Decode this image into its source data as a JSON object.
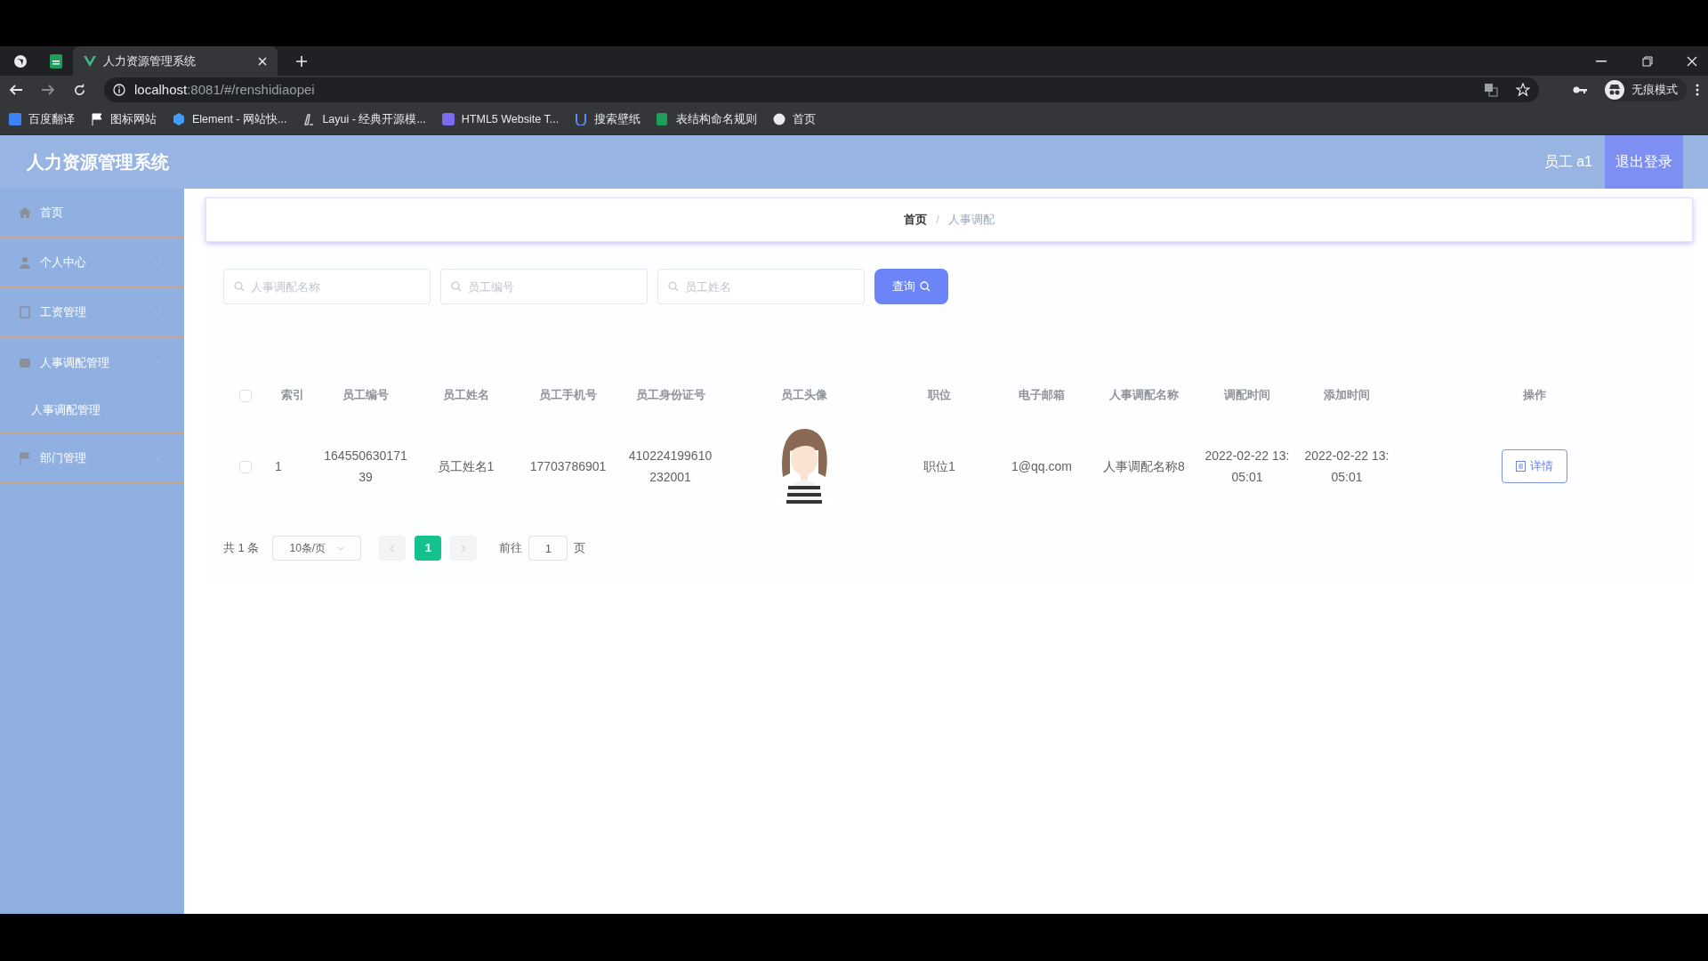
{
  "browser": {
    "tabs": [
      {
        "title": "人力资源管理系统",
        "selected": true
      }
    ],
    "address": {
      "host": "localhost",
      "rest": ":8081/#/renshidiaopei"
    },
    "bookmarks": [
      "百度翻译",
      "图标网站",
      "Element - 网站快...",
      "Layui - 经典开源模...",
      "HTML5 Website T...",
      "搜索壁纸",
      "表结构命名规则",
      "首页"
    ],
    "profile": "无痕模式"
  },
  "app": {
    "title": "人力资源管理系统",
    "user": "员工 a1",
    "logout": "退出登录"
  },
  "sidebar": {
    "items": [
      {
        "label": "首页"
      },
      {
        "label": "个人中心",
        "expanded": false
      },
      {
        "label": "工资管理",
        "expanded": false
      },
      {
        "label": "人事调配管理",
        "expanded": true,
        "children": [
          {
            "label": "人事调配管理"
          }
        ]
      },
      {
        "label": "部门管理",
        "expanded": false
      }
    ]
  },
  "breadcrumb": [
    "首页",
    "人事调配"
  ],
  "breadcrumb_separator": "/",
  "search": {
    "fields": [
      {
        "placeholder": "人事调配名称"
      },
      {
        "placeholder": "员工编号"
      },
      {
        "placeholder": "员工姓名"
      }
    ],
    "button": "查询"
  },
  "table": {
    "columns": [
      "索引",
      "员工编号",
      "员工姓名",
      "员工手机号",
      "员工身份证号",
      "员工头像",
      "职位",
      "电子邮箱",
      "人事调配名称",
      "调配时间",
      "添加时间",
      "操作"
    ],
    "header_checked": false,
    "rows": [
      {
        "checked": false,
        "cells": [
          "1",
          "16455063017139",
          "员工姓名1",
          "17703786901",
          "410224199610232001",
          {
            "kind": "picture"
          },
          "职位1",
          "1@qq.com",
          "人事调配名称8",
          "2022-02-22 13:05:01",
          "2022-02-22 13:05:01"
        ],
        "action": "详情"
      }
    ]
  },
  "pagination": {
    "total": "共 1 条",
    "page_size": "10条/页",
    "pages": [
      {
        "label": "1",
        "selected": true
      }
    ],
    "goto_label": "前往",
    "goto_value": "1",
    "goto_suffix": "页"
  }
}
